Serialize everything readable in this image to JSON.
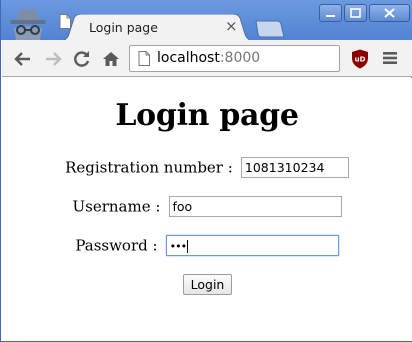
{
  "browser": {
    "tab": {
      "title": "Login page"
    },
    "address_bar": {
      "host": "localhost",
      "port": ":8000"
    },
    "colors": {
      "frame": "#5a89d6",
      "toolbar": "#f2f2f2",
      "ublock": "#8b0000"
    }
  },
  "page": {
    "title": "Login page",
    "form": {
      "registration": {
        "label": "Registration number :",
        "value": "1081310234"
      },
      "username": {
        "label": "Username :",
        "value": "foo"
      },
      "password": {
        "label": "Password :",
        "value": "•••"
      },
      "submit_label": "Login"
    }
  },
  "icons": {
    "incognito": "incognito-icon",
    "back": "back-arrow-icon",
    "forward": "forward-arrow-icon",
    "reload": "reload-icon",
    "home": "home-icon",
    "page": "page-icon",
    "extension": "ublock-icon",
    "menu": "hamburger-menu-icon"
  }
}
